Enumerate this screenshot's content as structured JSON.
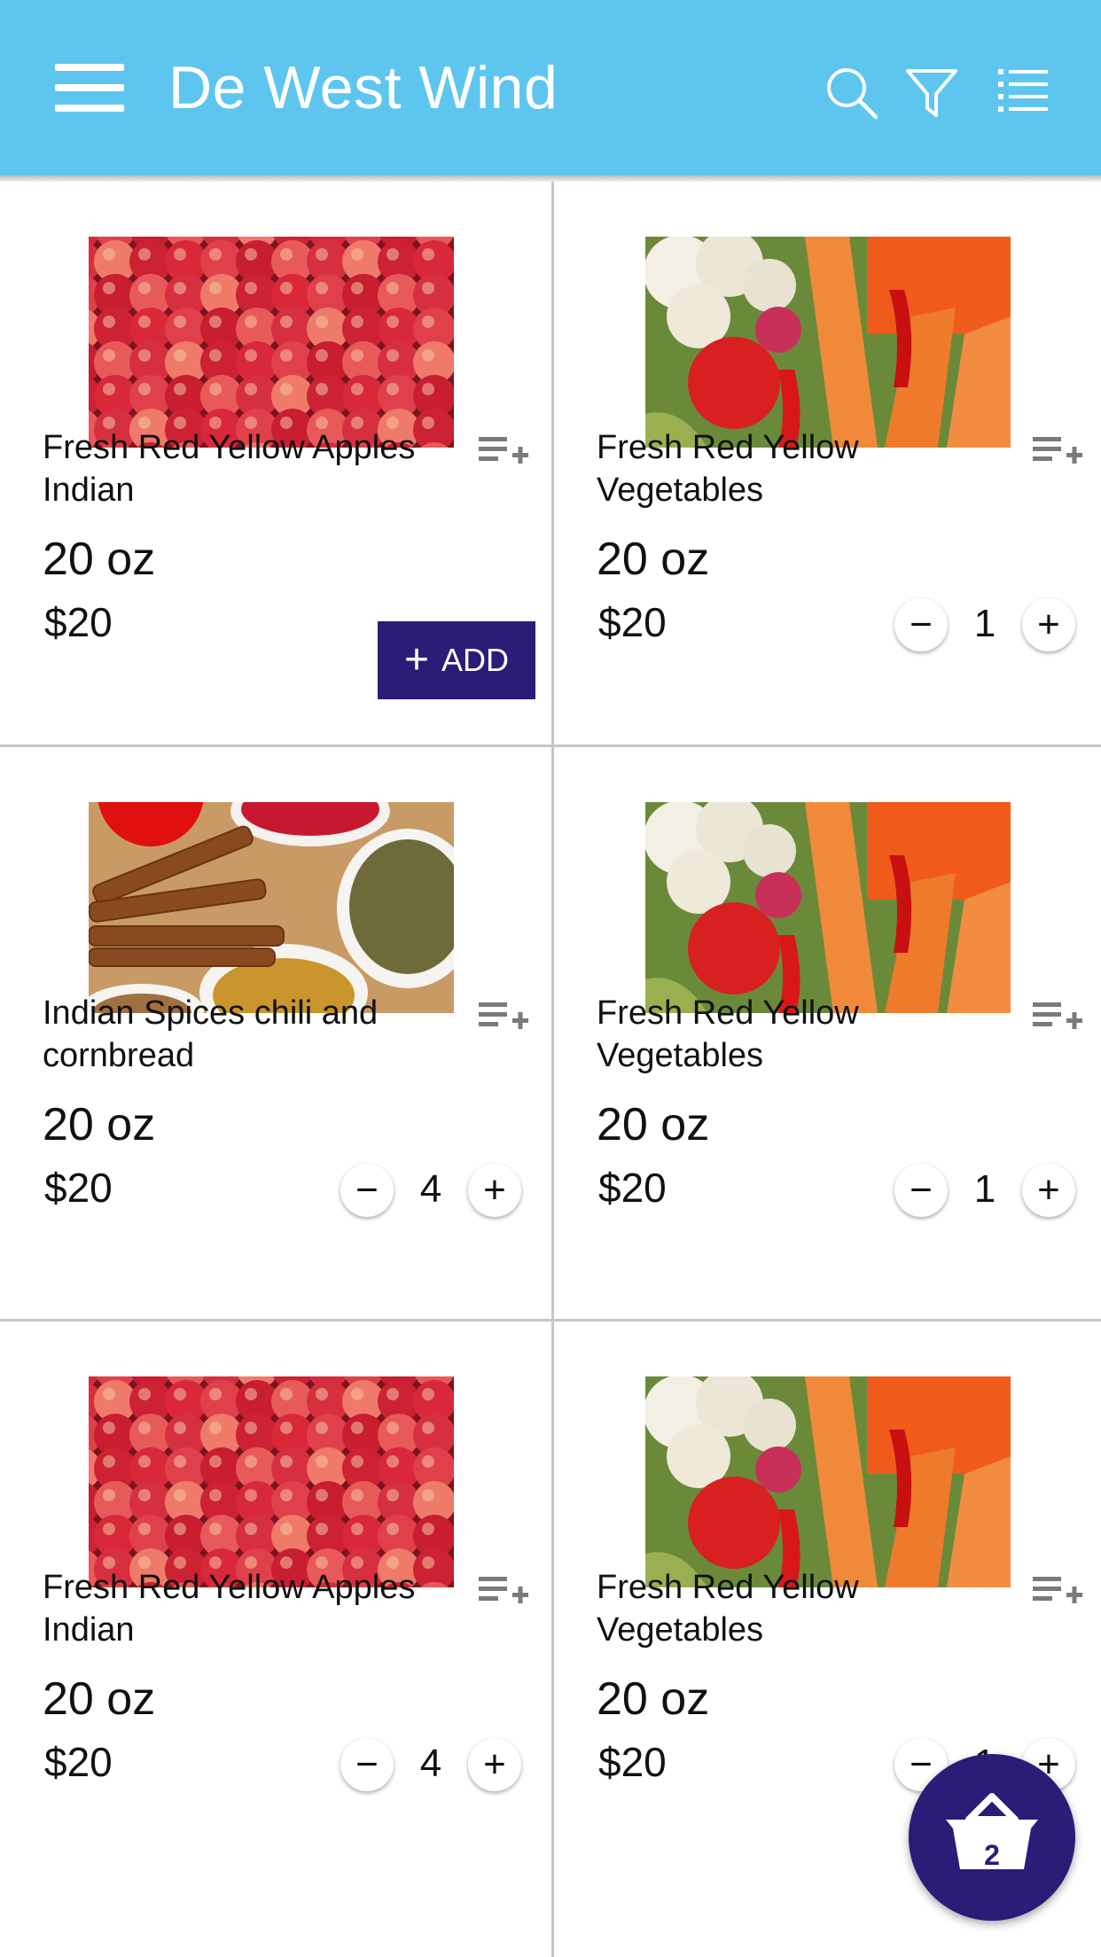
{
  "app": {
    "title": "De West Wind",
    "colors": {
      "appbar": "#5ec6ee",
      "accent": "#2b1c78"
    },
    "icons": [
      "menu-icon",
      "search-icon",
      "filter-icon",
      "list-view-icon"
    ]
  },
  "products": [
    {
      "name": "Fresh Red Yellow Apples Indian",
      "weight": "20 oz",
      "price": "$20",
      "image": "apples",
      "action": "add",
      "add_label": "ADD"
    },
    {
      "name": "Fresh Red Yellow Vegetables",
      "weight": "20 oz",
      "price": "$20",
      "image": "vegetables",
      "action": "stepper",
      "quantity": "1"
    },
    {
      "name": "Indian Spices chili and cornbread",
      "weight": "20 oz",
      "price": "$20",
      "image": "spices",
      "action": "stepper",
      "quantity": "4"
    },
    {
      "name": "Fresh Red Yellow Vegetables",
      "weight": "20 oz",
      "price": "$20",
      "image": "vegetables",
      "action": "stepper",
      "quantity": "1"
    },
    {
      "name": "Fresh Red Yellow Apples Indian",
      "weight": "20 oz",
      "price": "$20",
      "image": "apples",
      "action": "stepper",
      "quantity": "4"
    },
    {
      "name": "Fresh Red Yellow Vegetables",
      "weight": "20 oz",
      "price": "$20",
      "image": "vegetables",
      "action": "stepper",
      "quantity": "1"
    }
  ],
  "stepper": {
    "minus_symbol": "−",
    "plus_symbol": "+"
  },
  "cart": {
    "count": "2"
  }
}
